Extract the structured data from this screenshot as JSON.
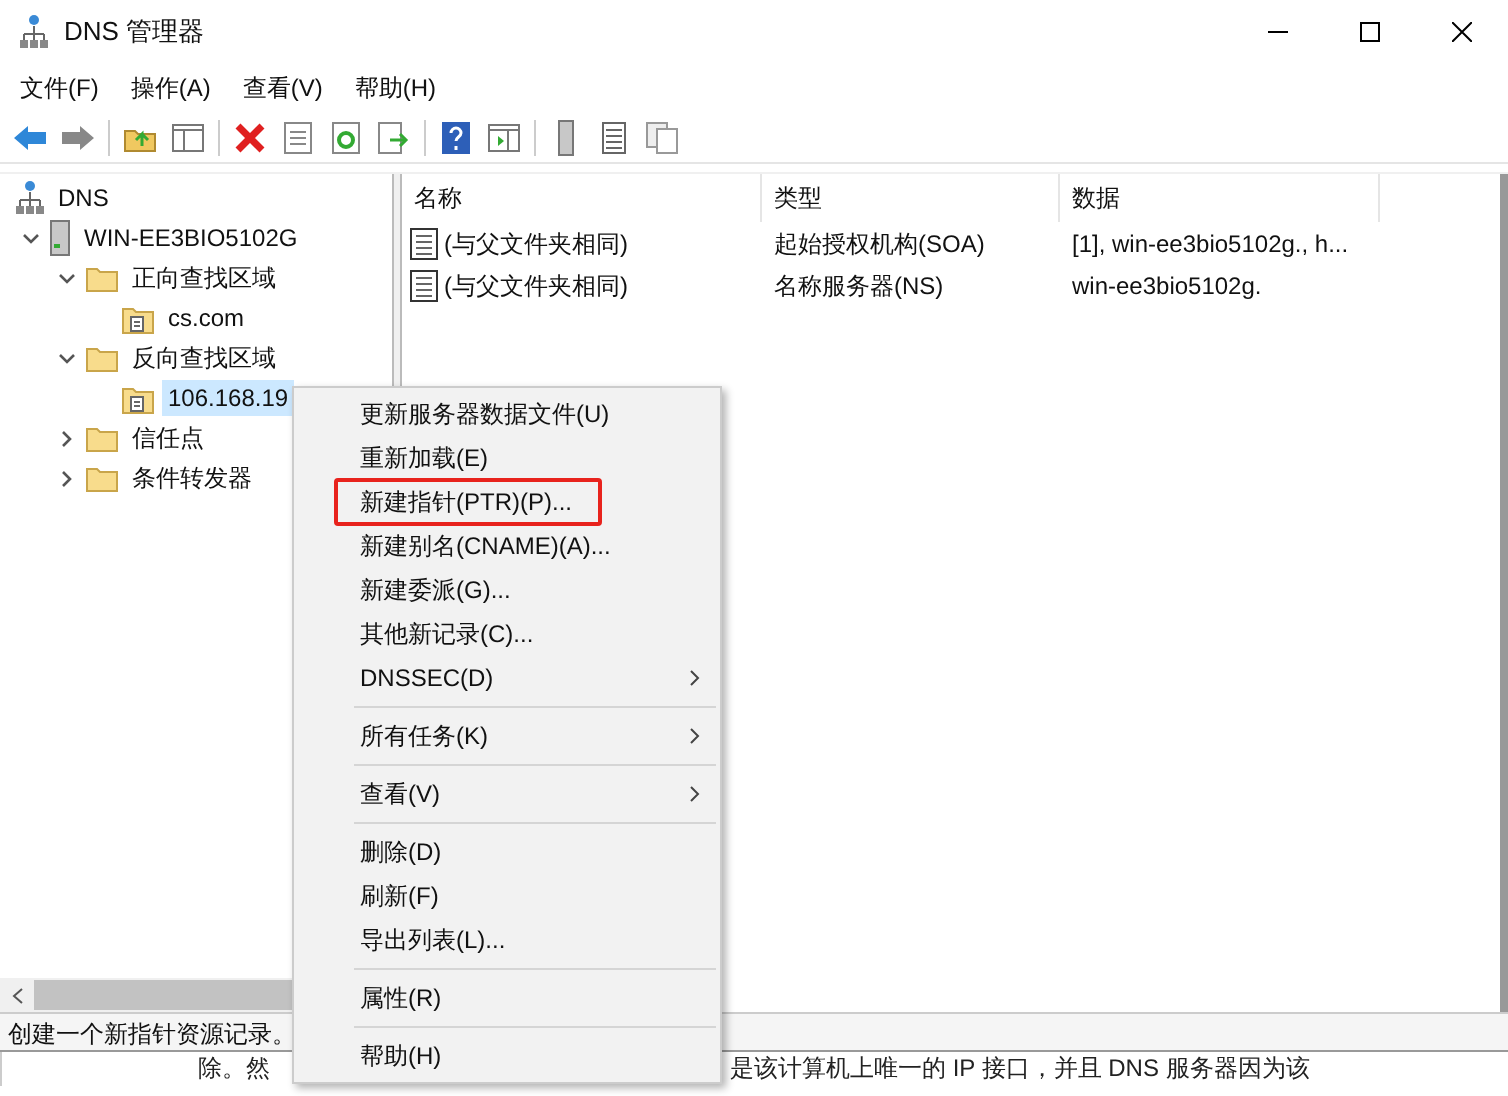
{
  "window": {
    "title": "DNS 管理器"
  },
  "menubar": [
    "文件(F)",
    "操作(A)",
    "查看(V)",
    "帮助(H)"
  ],
  "tree": [
    {
      "label": "DNS",
      "selected": false,
      "children": [
        {
          "label": "WIN-EE3BIO5102G",
          "expanded": true,
          "selected": false,
          "children": [
            {
              "label": "正向查找区域",
              "expanded": true,
              "selected": false,
              "children": [
                {
                  "label": "cs.com",
                  "selected": false
                }
              ]
            },
            {
              "label": "反向查找区域",
              "expanded": true,
              "selected": false,
              "children": [
                {
                  "label": "106.168.19",
                  "selected": true
                }
              ]
            },
            {
              "label": "信任点",
              "expanded": false,
              "selected": false
            },
            {
              "label": "条件转发器",
              "expanded": false,
              "selected": false
            }
          ]
        }
      ]
    }
  ],
  "table": {
    "columns": [
      "名称",
      "类型",
      "数据"
    ],
    "rows": [
      {
        "name": "(与父文件夹相同)",
        "type": "起始授权机构(SOA)",
        "data": "[1], win-ee3bio5102g., h..."
      },
      {
        "name": "(与父文件夹相同)",
        "type": "名称服务器(NS)",
        "data": "win-ee3bio5102g."
      }
    ]
  },
  "context_menu": [
    {
      "kind": "item",
      "label": "更新服务器数据文件(U)",
      "submenu": false,
      "highlighted": false
    },
    {
      "kind": "item",
      "label": "重新加载(E)",
      "submenu": false,
      "highlighted": false
    },
    {
      "kind": "item",
      "label": "新建指针(PTR)(P)...",
      "submenu": false,
      "highlighted": true
    },
    {
      "kind": "item",
      "label": "新建别名(CNAME)(A)...",
      "submenu": false,
      "highlighted": false
    },
    {
      "kind": "item",
      "label": "新建委派(G)...",
      "submenu": false,
      "highlighted": false
    },
    {
      "kind": "item",
      "label": "其他新记录(C)...",
      "submenu": false,
      "highlighted": false
    },
    {
      "kind": "item",
      "label": "DNSSEC(D)",
      "submenu": true,
      "highlighted": false
    },
    {
      "kind": "separator"
    },
    {
      "kind": "item",
      "label": "所有任务(K)",
      "submenu": true,
      "highlighted": false
    },
    {
      "kind": "separator"
    },
    {
      "kind": "item",
      "label": "查看(V)",
      "submenu": true,
      "highlighted": false
    },
    {
      "kind": "separator"
    },
    {
      "kind": "item",
      "label": "删除(D)",
      "submenu": false,
      "highlighted": false
    },
    {
      "kind": "item",
      "label": "刷新(F)",
      "submenu": false,
      "highlighted": false
    },
    {
      "kind": "item",
      "label": "导出列表(L)...",
      "submenu": false,
      "highlighted": false
    },
    {
      "kind": "separator"
    },
    {
      "kind": "item",
      "label": "属性(R)",
      "submenu": false,
      "highlighted": false
    },
    {
      "kind": "separator"
    },
    {
      "kind": "item",
      "label": "帮助(H)",
      "submenu": false,
      "highlighted": false
    }
  ],
  "status_bar": "创建一个新指针资源记录。",
  "background_text": [
    "除。然",
    "是该计算机上唯一的 IP 接口，并且 DNS 服务器因为该"
  ]
}
